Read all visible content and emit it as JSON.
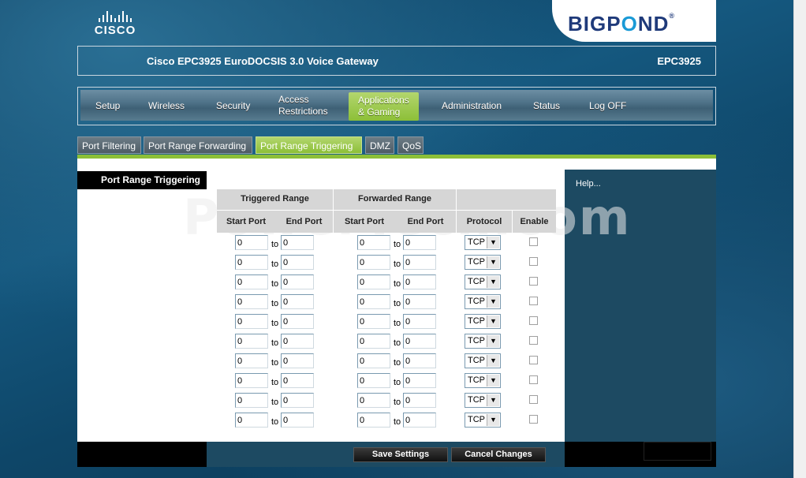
{
  "header": {
    "cisco_logo": "CISCO",
    "bigpond_logo_left": "BIGP",
    "bigpond_logo_o": "O",
    "bigpond_logo_right": "ND",
    "bigpond_reg": "®",
    "title": "Cisco EPC3925 EuroDOCSIS 3.0 Voice Gateway",
    "model": "EPC3925"
  },
  "nav": {
    "items": [
      {
        "label": "Setup"
      },
      {
        "label": "Wireless"
      },
      {
        "label": "Security"
      },
      {
        "label_line1": "Access",
        "label_line2": "Restrictions"
      },
      {
        "label_line1": "Applications",
        "label_line2": "& Gaming"
      },
      {
        "label": "Administration"
      },
      {
        "label": "Status"
      },
      {
        "label": "Log OFF"
      }
    ],
    "active_index": 4
  },
  "subtabs": {
    "items": [
      "Port Filtering",
      "Port Range Forwarding",
      "Port Range Triggering",
      "DMZ",
      "QoS"
    ],
    "active_index": 2
  },
  "sidebar": {
    "section_title": "Port Range Triggering"
  },
  "help": {
    "link": "Help..."
  },
  "watermark": "PowerTech.com",
  "table": {
    "group_triggered": "Triggered Range",
    "group_forwarded": "Forwarded Range",
    "col_start_port": "Start Port",
    "col_end_port": "End Port",
    "col_fwd_start_port": "Start Port",
    "col_fwd_end_port": "End Port",
    "col_protocol": "Protocol",
    "col_enable": "Enable",
    "to_label": "to",
    "rows": [
      {
        "trig_start": "0",
        "trig_end": "0",
        "fwd_start": "0",
        "fwd_end": "0",
        "protocol": "TCP",
        "enabled": false
      },
      {
        "trig_start": "0",
        "trig_end": "0",
        "fwd_start": "0",
        "fwd_end": "0",
        "protocol": "TCP",
        "enabled": false
      },
      {
        "trig_start": "0",
        "trig_end": "0",
        "fwd_start": "0",
        "fwd_end": "0",
        "protocol": "TCP",
        "enabled": false
      },
      {
        "trig_start": "0",
        "trig_end": "0",
        "fwd_start": "0",
        "fwd_end": "0",
        "protocol": "TCP",
        "enabled": false
      },
      {
        "trig_start": "0",
        "trig_end": "0",
        "fwd_start": "0",
        "fwd_end": "0",
        "protocol": "TCP",
        "enabled": false
      },
      {
        "trig_start": "0",
        "trig_end": "0",
        "fwd_start": "0",
        "fwd_end": "0",
        "protocol": "TCP",
        "enabled": false
      },
      {
        "trig_start": "0",
        "trig_end": "0",
        "fwd_start": "0",
        "fwd_end": "0",
        "protocol": "TCP",
        "enabled": false
      },
      {
        "trig_start": "0",
        "trig_end": "0",
        "fwd_start": "0",
        "fwd_end": "0",
        "protocol": "TCP",
        "enabled": false
      },
      {
        "trig_start": "0",
        "trig_end": "0",
        "fwd_start": "0",
        "fwd_end": "0",
        "protocol": "TCP",
        "enabled": false
      },
      {
        "trig_start": "0",
        "trig_end": "0",
        "fwd_start": "0",
        "fwd_end": "0",
        "protocol": "TCP",
        "enabled": false
      }
    ]
  },
  "buttons": {
    "save": "Save Settings",
    "cancel": "Cancel Changes"
  },
  "colors": {
    "accent_green": "#8cbf38",
    "panel_blue": "#1d4a62"
  }
}
